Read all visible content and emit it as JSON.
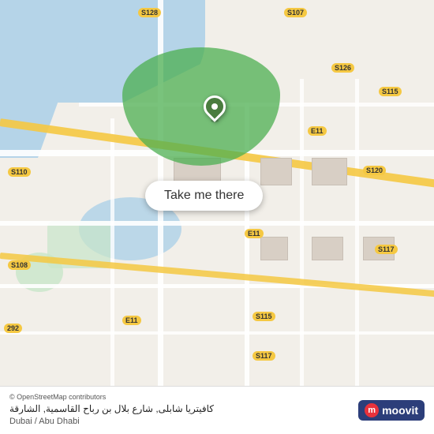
{
  "map": {
    "background_color": "#f2efe9",
    "water_color": "#b5d4e8",
    "road_color": "#ffffff",
    "highway_color": "#f5c842",
    "green_area_color": "#4CAF50"
  },
  "button": {
    "label": "Take me there"
  },
  "location": {
    "name": "كافيتريا شابلى, شارع بلال بن رباح القاسمية, الشارقة",
    "city": "Dubai / Abu Dhabi"
  },
  "footer": {
    "osm_credit": "© OpenStreetMap contributors",
    "logo_text": "moovit"
  },
  "road_labels": [
    {
      "id": "s128",
      "text": "S128"
    },
    {
      "id": "s107",
      "text": "S107"
    },
    {
      "id": "s126",
      "text": "S126"
    },
    {
      "id": "s115",
      "text": "S115"
    },
    {
      "id": "s110",
      "text": "S110"
    },
    {
      "id": "e11a",
      "text": "E11"
    },
    {
      "id": "e11b",
      "text": "E11"
    },
    {
      "id": "e11c",
      "text": "E11"
    },
    {
      "id": "s120",
      "text": "S120"
    },
    {
      "id": "s108",
      "text": "S108"
    },
    {
      "id": "s117a",
      "text": "S117"
    },
    {
      "id": "s115b",
      "text": "S115"
    },
    {
      "id": "s117b",
      "text": "S117"
    },
    {
      "id": "s292",
      "text": "292"
    }
  ]
}
